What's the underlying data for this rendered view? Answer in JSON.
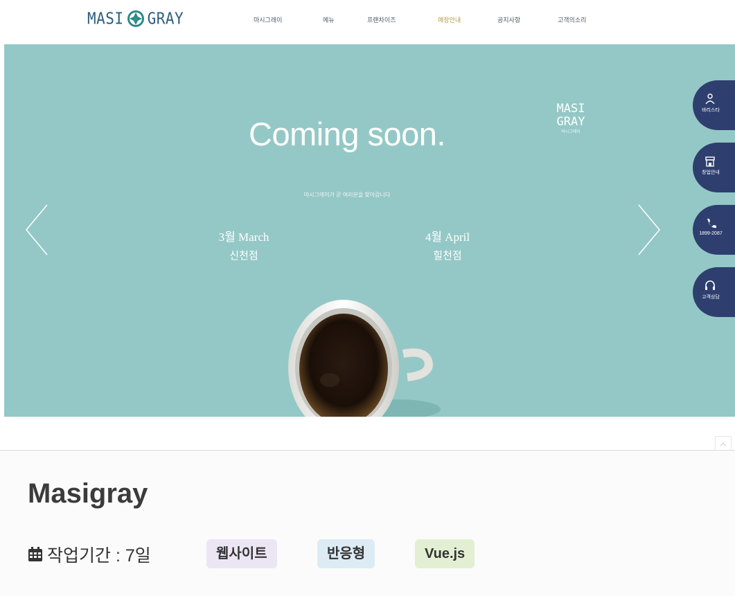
{
  "header": {
    "logo_text_left": "MASI",
    "logo_text_right": "GRAY",
    "nav": [
      {
        "label": "마시그레이"
      },
      {
        "label": "메뉴"
      },
      {
        "label": "프랜차이즈"
      },
      {
        "label": "매장안내"
      },
      {
        "label": "공지사항"
      },
      {
        "label": "고객의소리"
      }
    ]
  },
  "hero": {
    "title": "Coming soon.",
    "subtitle": "마시그레이가 곧 여러분을 찾아갑니다",
    "brand_line1": "MASI",
    "brand_line2": "GRAY",
    "brand_small": "마시그레이",
    "openings": [
      {
        "month": "3월 March",
        "store": "신천점"
      },
      {
        "month": "4월 April",
        "store": "힐천점"
      }
    ],
    "prev_icon": "chevron-left-icon",
    "next_icon": "chevron-right-icon"
  },
  "side_buttons": [
    {
      "label": "바리스타",
      "icon": "barista-icon"
    },
    {
      "label": "창업안내",
      "icon": "store-icon"
    },
    {
      "label": "1899-2087",
      "icon": "phone-icon"
    },
    {
      "label": "고객상담",
      "icon": "headset-icon"
    }
  ],
  "project": {
    "title": "Masigray",
    "period_icon": "calendar-icon",
    "period_text": "작업기간 : 7일",
    "tags": [
      {
        "label": "웹사이트",
        "color": "#ece6f4"
      },
      {
        "label": "반응형",
        "color": "#dcebf4"
      },
      {
        "label": "Vue.js",
        "color": "#e3efd2"
      }
    ]
  },
  "colors": {
    "hero_bg": "#94c8c6",
    "side_button": "#2e3f6f",
    "logo": "#2d5d80",
    "nav_accent": "#b09a3e"
  }
}
